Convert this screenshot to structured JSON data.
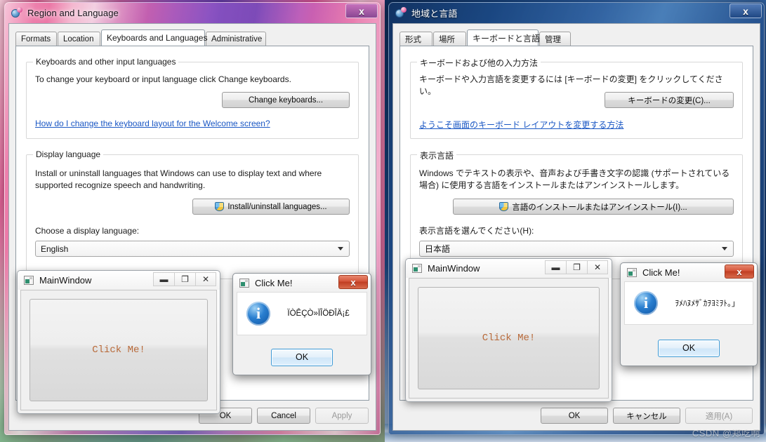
{
  "left_window": {
    "title": "Region and Language",
    "close_label": "x",
    "tabs": [
      {
        "label": "Formats",
        "active": false
      },
      {
        "label": "Location",
        "active": false
      },
      {
        "label": "Keyboards and Languages",
        "active": true
      },
      {
        "label": "Administrative",
        "active": false
      }
    ],
    "keyboards_group": {
      "legend": "Keyboards and other input languages",
      "description": "To change your keyboard or input language click Change keyboards.",
      "button_label": "Change keyboards...",
      "link_label": "How do I change the keyboard layout for the Welcome screen?"
    },
    "display_group": {
      "legend": "Display language",
      "description": "Install or uninstall languages that Windows can use to display text and where supported recognize speech and handwriting.",
      "button_label": "Install/uninstall languages...",
      "choose_label": "Choose a display language:",
      "combo_value": "English"
    },
    "footer": {
      "ok_label": "OK",
      "cancel_label": "Cancel",
      "apply_label": "Apply"
    }
  },
  "right_window": {
    "title": "地域と言語",
    "close_label": "x",
    "tabs": [
      {
        "label": "形式",
        "active": false
      },
      {
        "label": "場所",
        "active": false
      },
      {
        "label": "キーボードと言語",
        "active": true
      },
      {
        "label": "管理",
        "active": false
      }
    ],
    "keyboards_group": {
      "legend": "キーボードおよび他の入力方法",
      "description": "キーボードや入力言語を変更するには [キーボードの変更] をクリックしてください。",
      "button_label": "キーボードの変更(C)...",
      "link_label": "ようこそ画面のキーボード レイアウトを変更する方法"
    },
    "display_group": {
      "legend": "表示言語",
      "description": "Windows でテキストの表示や、音声および手書き文字の認識 (サポートされている場合) に使用する言語をインストールまたはアンインストールします。",
      "button_label": "言語のインストールまたはアンインストール(I)...",
      "choose_label": "表示言語を選んでください(H):",
      "combo_value": "日本語"
    },
    "footer": {
      "ok_label": "OK",
      "cancel_label": "キャンセル",
      "apply_label": "適用(A)"
    }
  },
  "left_mainwindow": {
    "title": "MainWindow",
    "minimize_label": "▬",
    "restore_label": "❐",
    "close_label": "✕",
    "button_label": "Click Me!"
  },
  "right_mainwindow": {
    "title": "MainWindow",
    "minimize_label": "▬",
    "restore_label": "❐",
    "close_label": "✕",
    "button_label": "Click Me!"
  },
  "left_msgbox": {
    "title": "Click Me!",
    "close_label": "x",
    "message": "ÏÒÊÇÒ»ÏÎÖÐÎÄ¡£",
    "ok_label": "OK"
  },
  "right_msgbox": {
    "title": "Click Me!",
    "close_label": "x",
    "message": "ｦﾒﾊﾇﾒｻﾞｶｦﾖﾐｦﾄ｡｣",
    "ok_label": "OK"
  },
  "watermark": {
    "text": "CSDN @郑吃啊"
  },
  "colors": {
    "left_titlebar": "#e8649b",
    "right_titlebar": "#1c4882",
    "link": "#1a57c4",
    "button_text": "#b86a3a",
    "close_red": "#c03d22"
  }
}
